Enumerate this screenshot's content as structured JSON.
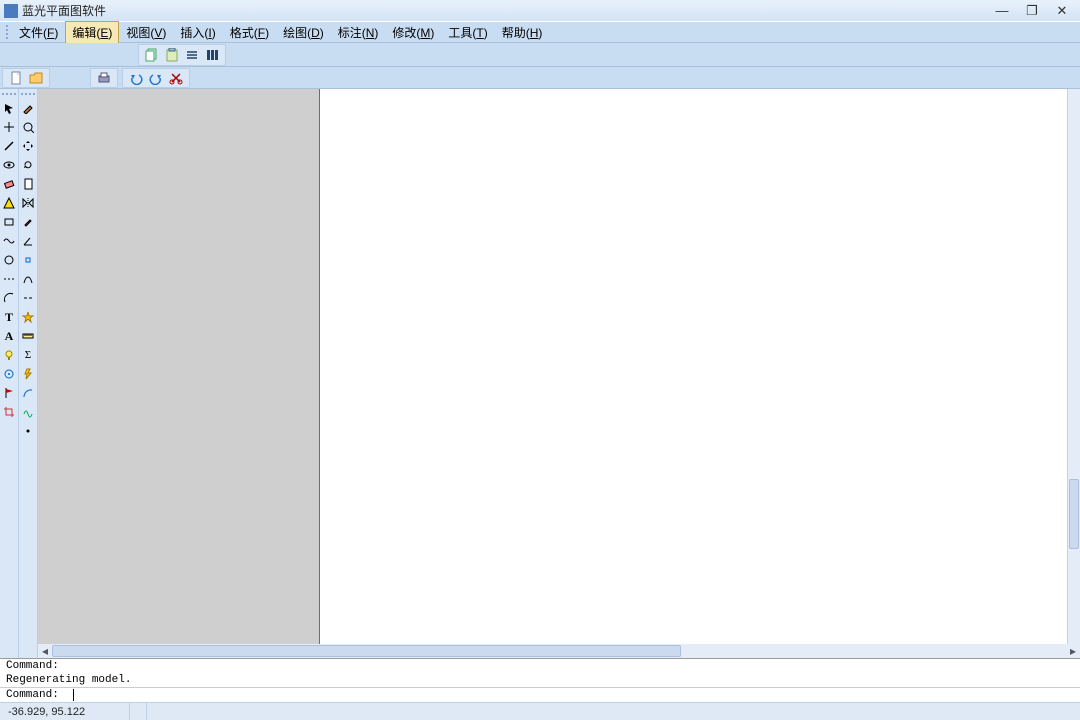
{
  "app": {
    "title": "蓝光平面图软件"
  },
  "window_controls": {
    "minimize": "—",
    "maximize": "❐",
    "close": "✕"
  },
  "menu": {
    "items": [
      {
        "label": "文件",
        "key": "F"
      },
      {
        "label": "编辑",
        "key": "E",
        "active": true
      },
      {
        "label": "视图",
        "key": "V"
      },
      {
        "label": "插入",
        "key": "I"
      },
      {
        "label": "格式",
        "key": "F"
      },
      {
        "label": "绘图",
        "key": "D"
      },
      {
        "label": "标注",
        "key": "N"
      },
      {
        "label": "修改",
        "key": "M"
      },
      {
        "label": "工具",
        "key": "T"
      },
      {
        "label": "帮助",
        "key": "H"
      }
    ]
  },
  "topbar_icons": [
    "copy-icon",
    "paste-icon",
    "list-icon",
    "columns-icon"
  ],
  "secondbar_left_icons": [
    "new-file-icon",
    "open-folder-icon"
  ],
  "secondbar_right_icons": [
    "print-icon",
    "undo-icon",
    "redo-icon",
    "cut-icon"
  ],
  "tool_left_col": [
    "select-icon",
    "move-icon",
    "line-icon",
    "eye-icon",
    "eraser-icon",
    "warning-icon",
    "rect-icon",
    "wave-icon",
    "circle-icon",
    "dash-icon",
    "arc-icon",
    "text-t-icon",
    "text-a-icon",
    "bulb-icon",
    "target-icon",
    "flag-icon",
    "crop-icon"
  ],
  "tool_right_col": [
    "brush-icon",
    "loop-icon",
    "move4-icon",
    "rotate-icon",
    "page-icon",
    "mirror-icon",
    "dropper-icon",
    "angle-icon",
    "snap-icon",
    "curve-icon",
    "break-icon",
    "star-icon",
    "measure-icon",
    "sum-icon",
    "bolt-icon",
    "multi-icon",
    "spline-icon",
    "pointer-icon"
  ],
  "command": {
    "line1": "Command:",
    "line2": " Regenerating model.",
    "prompt": "Command:"
  },
  "status": {
    "coords": "-36.929,   95.122"
  }
}
